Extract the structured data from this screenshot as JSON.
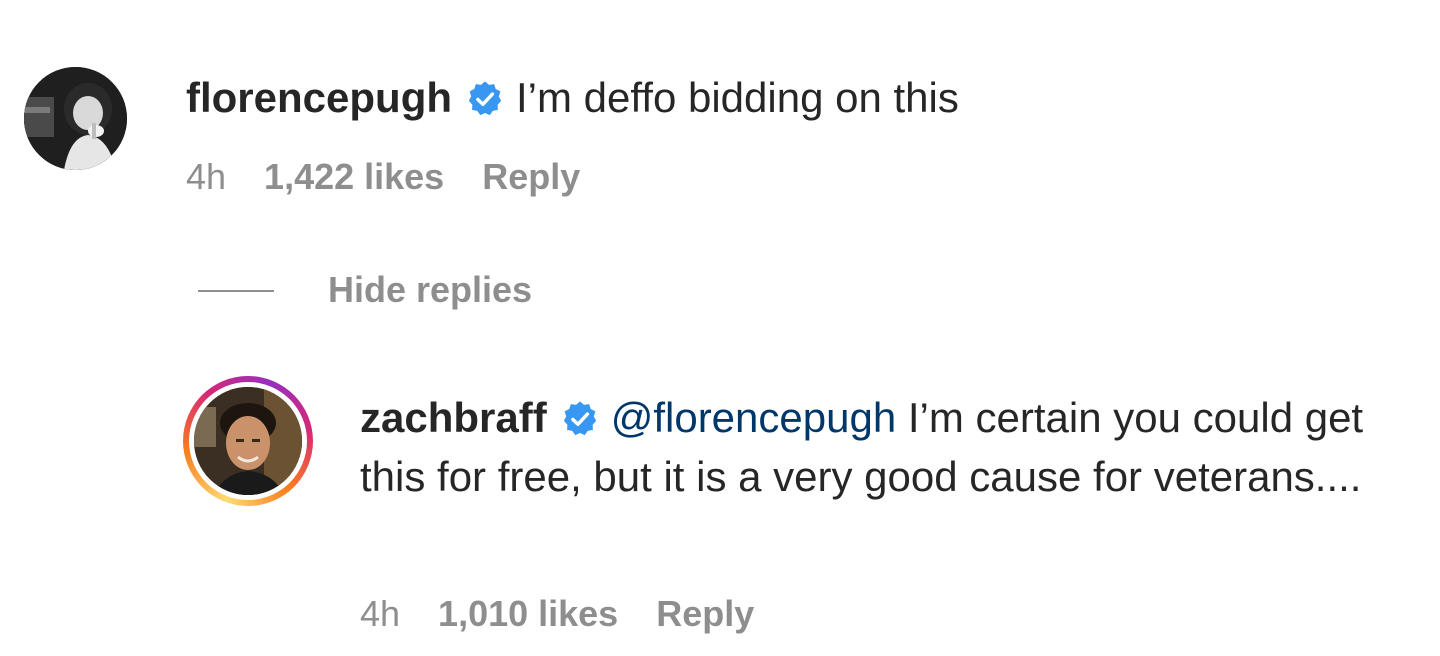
{
  "comments": [
    {
      "username": "florencepugh",
      "verified": true,
      "text": "I’m deffo bidding on this",
      "time": "4h",
      "likes": "1,422 likes",
      "reply": "Reply"
    }
  ],
  "replies_toggle": {
    "label": "Hide replies"
  },
  "replies": [
    {
      "username": "zachbraff",
      "verified": true,
      "mention": "@florencepugh",
      "text": " I’m certain you could get this for free, but it is a very good cause for veterans....",
      "time": "4h",
      "likes": "1,010 likes",
      "reply": "Reply"
    }
  ],
  "colors": {
    "text": "#262626",
    "secondary": "#8e8e8e",
    "verified": "#3897f0",
    "mention": "#00376b"
  }
}
